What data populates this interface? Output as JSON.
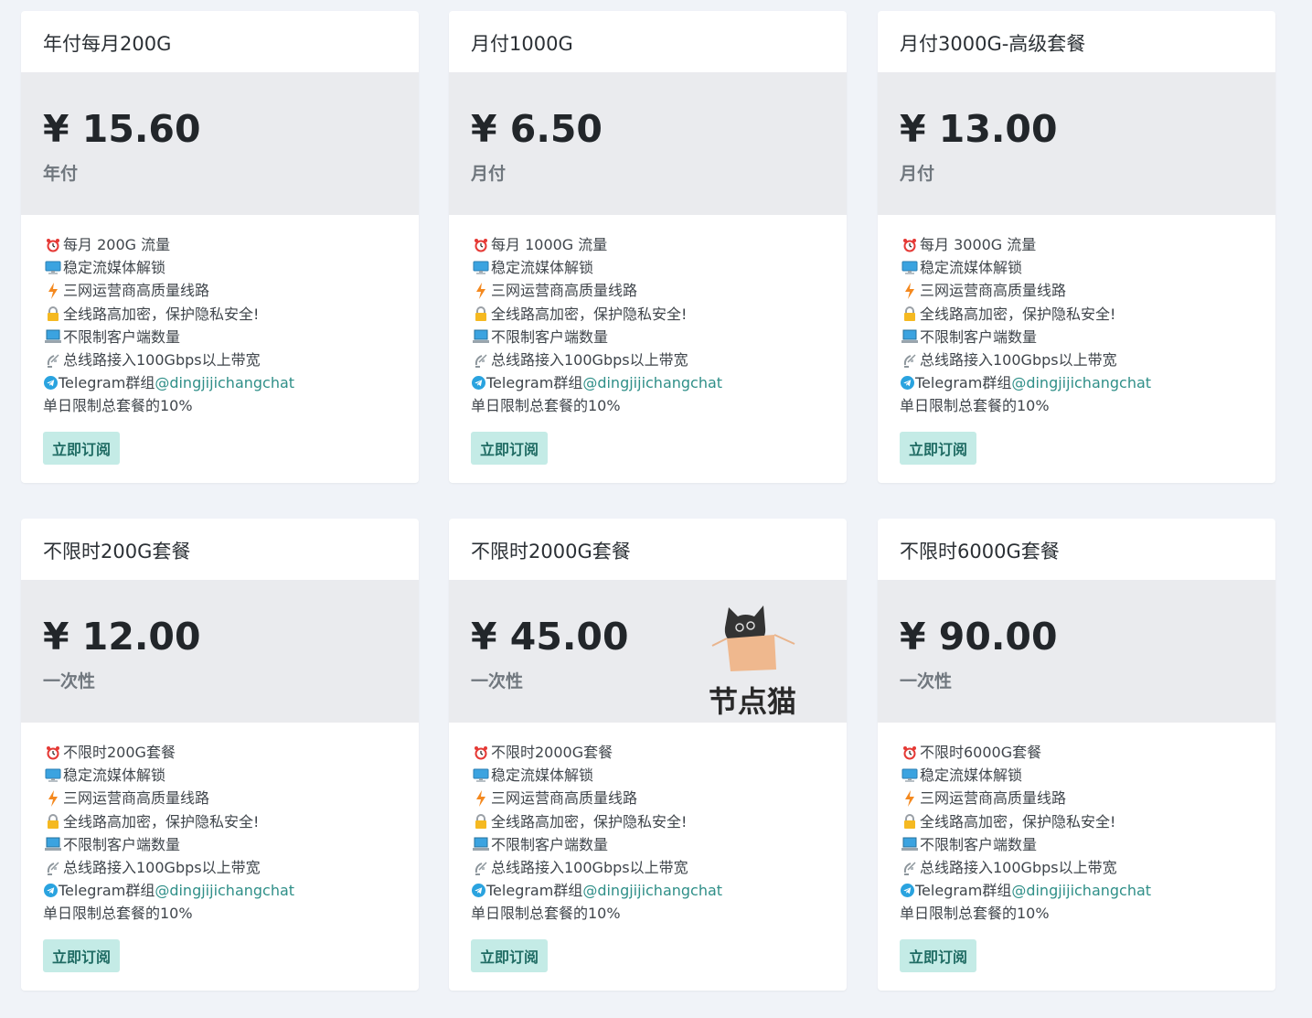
{
  "plans": [
    {
      "title": "年付每月200G",
      "price": "¥ 15.60",
      "period": "年付",
      "features": [
        "每月 200G 流量",
        "稳定流媒体解锁",
        "三网运营商高质量线路",
        "全线路高加密，保护隐私安全!",
        "不限制客户端数量",
        "总线路接入100Gbps以上带宽"
      ],
      "telegram_prefix": "Telegram群组",
      "telegram_handle": "@dingjijichangchat",
      "limit": "单日限制总套餐的10%",
      "button": "立即订阅"
    },
    {
      "title": "月付1000G",
      "price": "¥ 6.50",
      "period": "月付",
      "features": [
        "每月 1000G 流量",
        "稳定流媒体解锁",
        "三网运营商高质量线路",
        "全线路高加密，保护隐私安全!",
        "不限制客户端数量",
        "总线路接入100Gbps以上带宽"
      ],
      "telegram_prefix": "Telegram群组",
      "telegram_handle": "@dingjijichangchat",
      "limit": "单日限制总套餐的10%",
      "button": "立即订阅"
    },
    {
      "title": "月付3000G-高级套餐",
      "price": "¥ 13.00",
      "period": "月付",
      "features": [
        "每月 3000G 流量",
        "稳定流媒体解锁",
        "三网运营商高质量线路",
        "全线路高加密，保护隐私安全!",
        "不限制客户端数量",
        "总线路接入100Gbps以上带宽"
      ],
      "telegram_prefix": "Telegram群组",
      "telegram_handle": "@dingjijichangchat",
      "limit": "单日限制总套餐的10%",
      "button": "立即订阅"
    },
    {
      "title": "不限时200G套餐",
      "price": "¥ 12.00",
      "period": "一次性",
      "features": [
        "不限时200G套餐",
        "稳定流媒体解锁",
        "三网运营商高质量线路",
        "全线路高加密，保护隐私安全!",
        "不限制客户端数量",
        "总线路接入100Gbps以上带宽"
      ],
      "telegram_prefix": "Telegram群组",
      "telegram_handle": "@dingjijichangchat",
      "limit": "单日限制总套餐的10%",
      "button": "立即订阅"
    },
    {
      "title": "不限时2000G套餐",
      "price": "¥ 45.00",
      "period": "一次性",
      "features": [
        "不限时2000G套餐",
        "稳定流媒体解锁",
        "三网运营商高质量线路",
        "全线路高加密，保护隐私安全!",
        "不限制客户端数量",
        "总线路接入100Gbps以上带宽"
      ],
      "telegram_prefix": "Telegram群组",
      "telegram_handle": "@dingjijichangchat",
      "limit": "单日限制总套餐的10%",
      "button": "立即订阅"
    },
    {
      "title": "不限时6000G套餐",
      "price": "¥ 90.00",
      "period": "一次性",
      "features": [
        "不限时6000G套餐",
        "稳定流媒体解锁",
        "三网运营商高质量线路",
        "全线路高加密，保护隐私安全!",
        "不限制客户端数量",
        "总线路接入100Gbps以上带宽"
      ],
      "telegram_prefix": "Telegram群组",
      "telegram_handle": "@dingjijichangchat",
      "limit": "单日限制总套餐的10%",
      "button": "立即订阅"
    }
  ],
  "feature_icons": [
    "alarm-clock-icon",
    "monitor-icon",
    "lightning-icon",
    "lock-icon",
    "laptop-icon",
    "satellite-icon"
  ],
  "watermark": {
    "text": "节点猫"
  },
  "colors": {
    "accent": "#2f8f88",
    "button_bg": "#c4ebe6",
    "button_text": "#1f6b63",
    "price_bg": "#eaebee",
    "page_bg": "#f0f3f8"
  }
}
